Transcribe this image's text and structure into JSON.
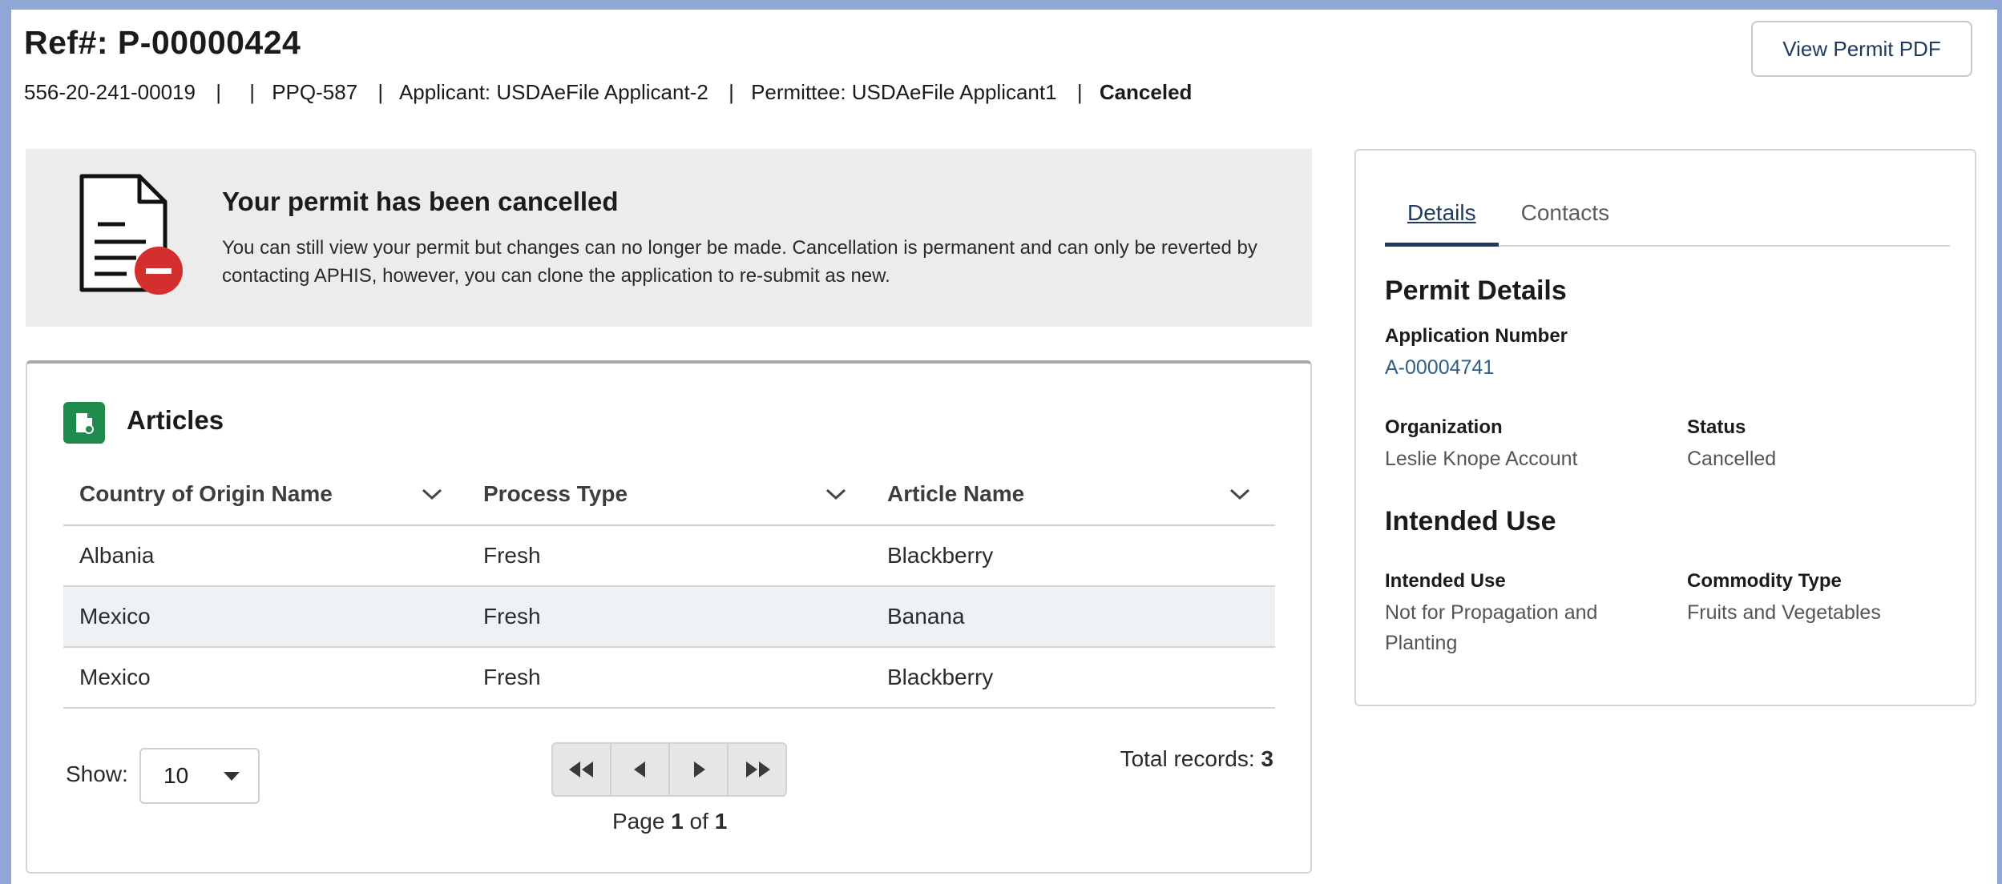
{
  "header": {
    "title": "Ref#: P-00000424",
    "view_pdf_label": "View Permit PDF",
    "meta": {
      "id": "556-20-241-00019",
      "sep1": "|",
      "sep2": "|",
      "ppq": "PPQ-587",
      "sep3": "|",
      "applicant": "Applicant: USDAeFile Applicant-2",
      "sep4": "|",
      "permittee": "Permittee: USDAeFile Applicant1",
      "sep5": "|",
      "status": "Canceled"
    }
  },
  "banner": {
    "title": "Your permit has been cancelled",
    "text": "You can still view your permit but changes can no longer be made. Cancellation is permanent and can only be reverted by contacting APHIS, however, you can clone the application to re-submit as new.",
    "icon": "document-cancelled-icon",
    "accent": "#d32f2f"
  },
  "articles": {
    "title": "Articles",
    "icon": "articles-icon",
    "columns": [
      "Country of Origin Name",
      "Process Type",
      "Article Name"
    ],
    "rows": [
      [
        "Albania",
        "Fresh",
        "Blackberry"
      ],
      [
        "Mexico",
        "Fresh",
        "Banana"
      ],
      [
        "Mexico",
        "Fresh",
        "Blackberry"
      ]
    ],
    "show_label": "Show:",
    "page_size": "10",
    "page_prefix": "Page",
    "page_current": "1",
    "page_of": "of",
    "page_total": "1",
    "total_label": "Total records:",
    "total_value": "3"
  },
  "side": {
    "tabs": [
      "Details",
      "Contacts"
    ],
    "permit_details_title": "Permit Details",
    "application_number_label": "Application Number",
    "application_number": "A-00004741",
    "organization_label": "Organization",
    "organization": "Leslie Knope Account",
    "status_label": "Status",
    "status": "Cancelled",
    "intended_use_title": "Intended Use",
    "intended_use_label": "Intended Use",
    "intended_use": "Not for Propagation and Planting",
    "commodity_type_label": "Commodity Type",
    "commodity_type": "Fruits and Vegetables"
  },
  "colors": {
    "frame": "#8fa6d6",
    "link": "#2d5f8a",
    "articles_icon": "#1e8a4c"
  }
}
